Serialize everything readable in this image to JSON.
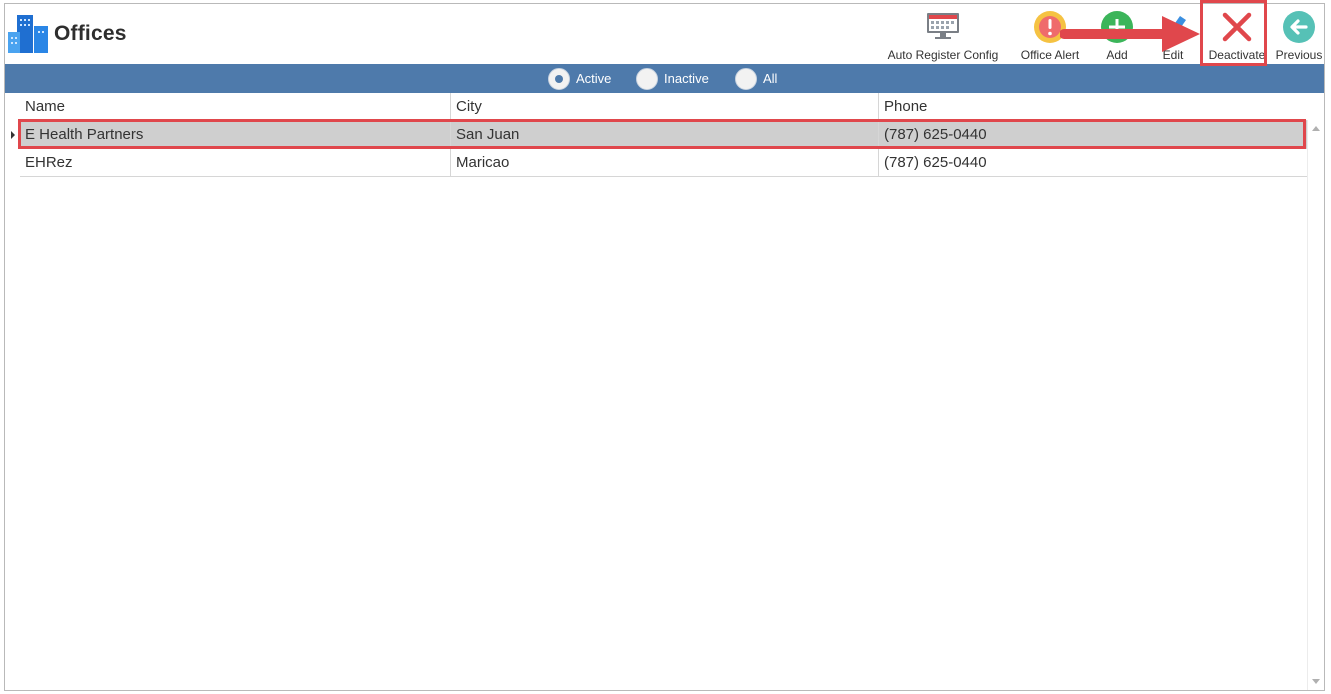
{
  "header": {
    "title": "Offices"
  },
  "toolbar": {
    "auto_register": "Auto Register Config",
    "office_alert": "Office Alert",
    "add": "Add",
    "edit": "Edit",
    "deactivate": "Deactivate",
    "previous": "Previous"
  },
  "filter": {
    "options": [
      "Active",
      "Inactive",
      "All"
    ],
    "selected": "Active"
  },
  "grid": {
    "columns": [
      "Name",
      "City",
      "Phone"
    ],
    "rows": [
      {
        "name": "E Health Partners",
        "city": "San Juan",
        "phone": "(787) 625-0440",
        "selected": true
      },
      {
        "name": "EHRez",
        "city": "Maricao",
        "phone": "(787) 625-0440",
        "selected": false
      }
    ]
  },
  "colors": {
    "filter_bar": "#4e7aab",
    "highlight": "#e0474c",
    "selected_row": "#cfcfcf"
  }
}
